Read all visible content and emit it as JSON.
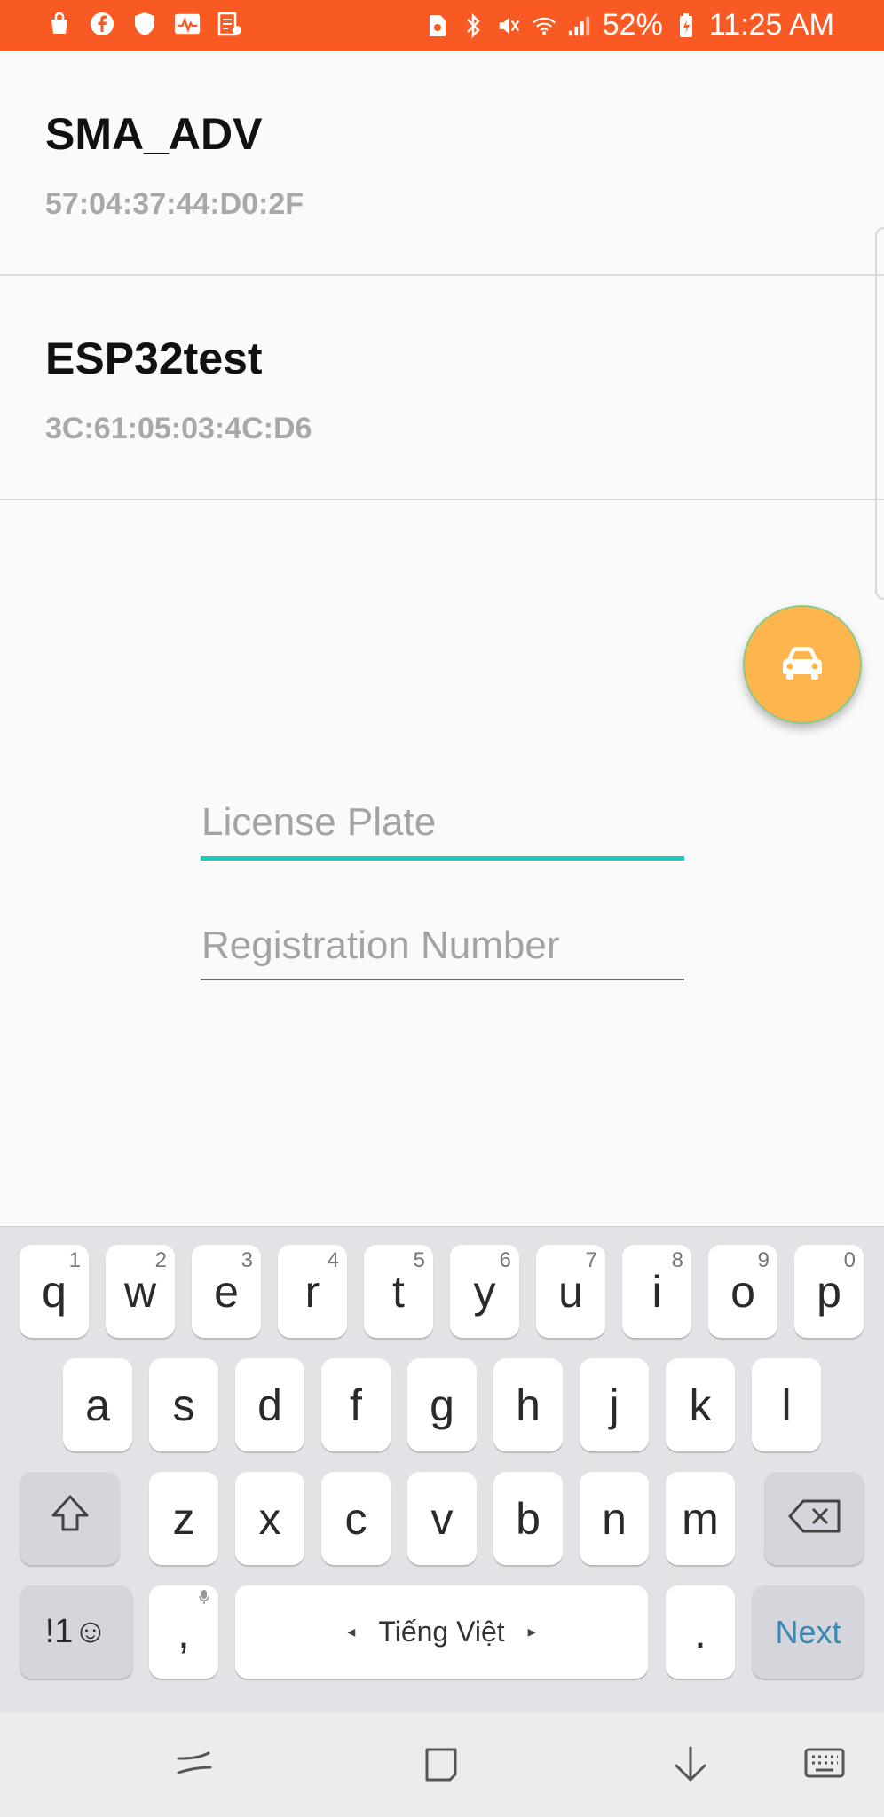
{
  "status_bar": {
    "battery_percent": "52%",
    "time": "11:25 AM",
    "left_icons": [
      "shopping-bag-icon",
      "facebook-icon",
      "shield-icon",
      "activity-icon",
      "receipt-icon"
    ],
    "right_icons": [
      "sim-icon",
      "bluetooth-icon",
      "mute-icon",
      "wifi-icon",
      "signal-icon",
      "battery-icon"
    ],
    "bg_color": "#f95a23"
  },
  "devices": [
    {
      "name": "SMA_ADV",
      "address": "57:04:37:44:D0:2F"
    },
    {
      "name": "ESP32test",
      "address": "3C:61:05:03:4C:D6"
    }
  ],
  "fab": {
    "icon": "car-icon",
    "color": "#ffb54d"
  },
  "form": {
    "license_plate": {
      "placeholder": "License Plate",
      "value": ""
    },
    "registration_number": {
      "placeholder": "Registration Number",
      "value": ""
    },
    "focus_color": "#21c9bd"
  },
  "keyboard": {
    "row1": [
      {
        "key": "q",
        "hint": "1"
      },
      {
        "key": "w",
        "hint": "2"
      },
      {
        "key": "e",
        "hint": "3"
      },
      {
        "key": "r",
        "hint": "4"
      },
      {
        "key": "t",
        "hint": "5"
      },
      {
        "key": "y",
        "hint": "6"
      },
      {
        "key": "u",
        "hint": "7"
      },
      {
        "key": "i",
        "hint": "8"
      },
      {
        "key": "o",
        "hint": "9"
      },
      {
        "key": "p",
        "hint": "0"
      }
    ],
    "row2": [
      "a",
      "s",
      "d",
      "f",
      "g",
      "h",
      "j",
      "k",
      "l"
    ],
    "row3": [
      "z",
      "x",
      "c",
      "v",
      "b",
      "n",
      "m"
    ],
    "symbols_label": "!1☺",
    "comma_label": ",",
    "space_label": "Tiếng Việt",
    "period_label": ".",
    "next_label": "Next"
  },
  "navbar": {
    "icons": [
      "recents-icon",
      "home-icon",
      "back-icon",
      "keyboard-icon"
    ]
  }
}
